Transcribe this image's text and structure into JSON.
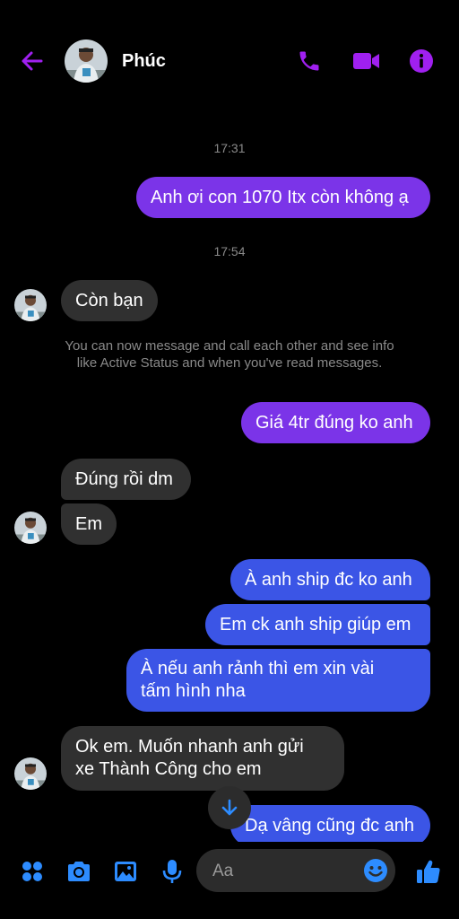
{
  "header": {
    "contact_name": "Phúc",
    "icons": [
      "back-arrow-icon",
      "phone-icon",
      "video-camera-icon",
      "info-icon"
    ]
  },
  "messages": {
    "time_1": "17:31",
    "msg_1": "Anh ơi con 1070 Itx còn không ạ",
    "time_2": "17:54",
    "msg_2": "Còn bạn",
    "system_note": "You can now message and call each other and see info like Active Status and when you've read messages.",
    "msg_3": "Giá 4tr đúng ko anh",
    "msg_4": "Đúng rồi dm",
    "msg_5": "Em",
    "msg_6": "À anh ship đc ko anh",
    "msg_7": "Em ck anh ship giúp em",
    "msg_8": "À nếu anh rảnh thì em xin vài tấm hình nha",
    "msg_9": "Ok em. Muốn nhanh anh gửi xe Thành Công cho em",
    "msg_10": "Dạ vâng cũng đc anh"
  },
  "composer": {
    "placeholder": "Aa",
    "icons": [
      "menu-dots-icon",
      "camera-icon",
      "image-icon",
      "microphone-icon",
      "emoji-icon",
      "thumbs-up-icon"
    ]
  },
  "colors": {
    "accent_purple": "#a020f0",
    "accent_blue": "#1e6ff0",
    "bubble_out_purple": "#7b34e8",
    "bubble_out_blue": "#3b55e6",
    "bubble_in": "#303030"
  }
}
